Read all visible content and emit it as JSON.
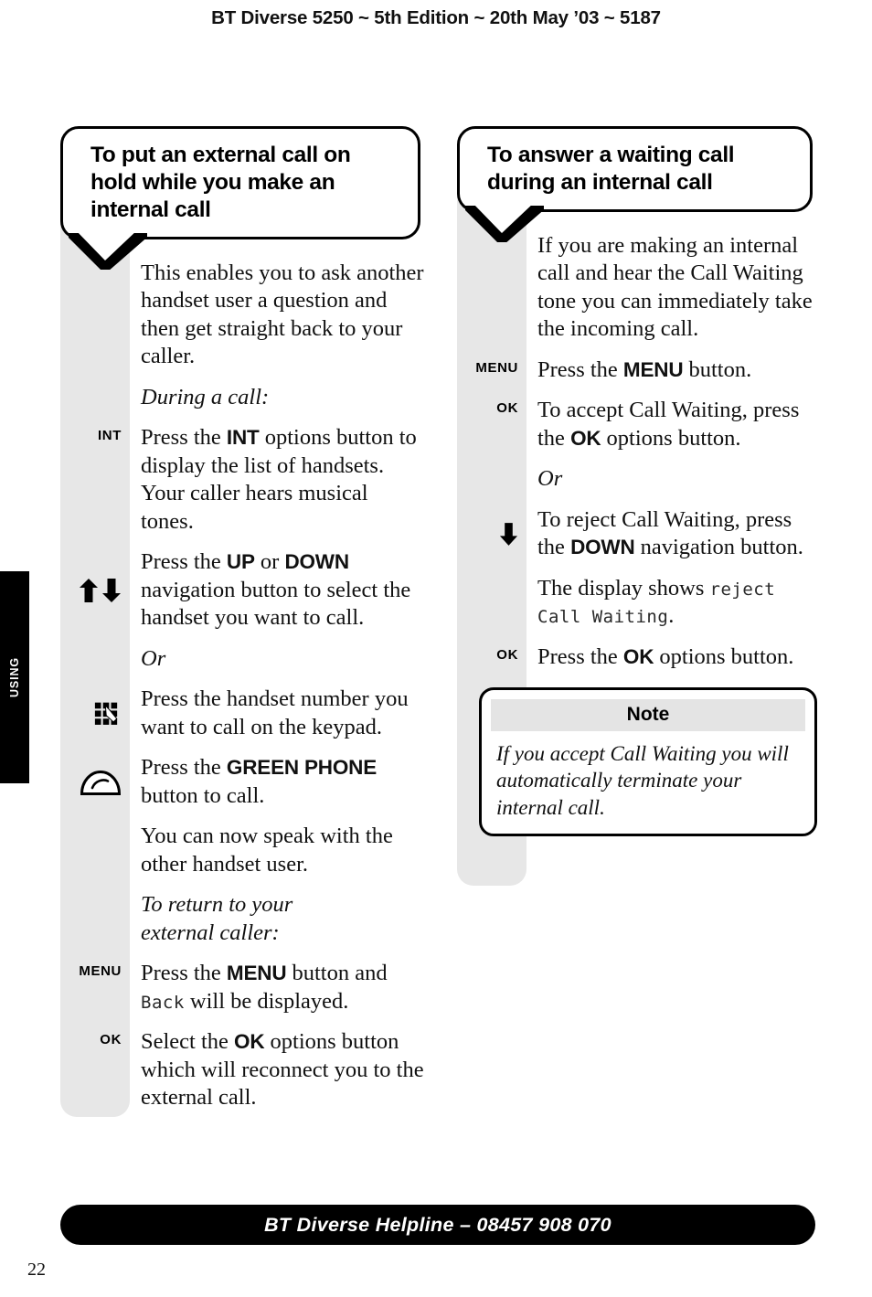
{
  "running_head": "BT Diverse 5250 ~ 5th Edition ~ 20th May ’03 ~ 5187",
  "section_tab": {
    "label": "USING"
  },
  "page_number": "22",
  "footer": {
    "text": "BT Diverse Helpline – 08457 908 070"
  },
  "left_column": {
    "heading": "To put an external call on hold while you make an internal call",
    "steps": [
      {
        "cue": "",
        "cue_icon": "",
        "text_html": "This enables you to ask another handset user a question and then get straight back to your caller."
      },
      {
        "cue": "",
        "cue_icon": "",
        "text_html": "During a call:",
        "style": "italic"
      },
      {
        "cue": "INT",
        "cue_icon": "",
        "text_html": "Press the <b>INT</b> options button to display the list of handsets. Your caller hears musical tones."
      },
      {
        "cue": "",
        "cue_icon": "up-down-arrows-icon",
        "text_html": "Press the <b>UP</b> or <b>DOWN</b> navigation button to select the handset you want to call."
      },
      {
        "cue": "",
        "cue_icon": "",
        "text_html": "Or",
        "style": "italic"
      },
      {
        "cue": "",
        "cue_icon": "keypad-icon",
        "text_html": "Press the handset number you want to call on the keypad."
      },
      {
        "cue": "",
        "cue_icon": "green-phone-icon",
        "text_html": "Press the <b>GREEN PHONE</b> button to call."
      },
      {
        "cue": "",
        "cue_icon": "",
        "text_html": "You can now speak with the other handset user."
      },
      {
        "cue": "",
        "cue_icon": "",
        "text_html": "To return to your<br>external caller:",
        "style": "italic"
      },
      {
        "cue": "MENU",
        "cue_icon": "",
        "text_html": "Press the <b>MENU</b> button and <span class=\"lcd\">Back</span> will be displayed."
      },
      {
        "cue": "OK",
        "cue_icon": "",
        "text_html": "Select the <b>OK</b> options button which will reconnect you to the external call."
      }
    ]
  },
  "right_column": {
    "heading": "To answer a waiting call during an internal call",
    "steps": [
      {
        "cue": "",
        "cue_icon": "",
        "text_html": "If you are making an internal call and hear the Call Waiting tone you can immediately take the incoming call."
      },
      {
        "cue": "MENU",
        "cue_icon": "",
        "text_html": "Press the <b>MENU</b> button."
      },
      {
        "cue": "OK",
        "cue_icon": "",
        "text_html": "To accept Call Waiting, press the <b>OK</b> options button."
      },
      {
        "cue": "",
        "cue_icon": "",
        "text_html": "Or",
        "style": "italic"
      },
      {
        "cue": "",
        "cue_icon": "down-arrow-icon",
        "text_html": "To reject Call Waiting, press the <b>DOWN</b> navigation button."
      },
      {
        "cue": "",
        "cue_icon": "",
        "text_html": "The display shows <span class=\"lcd\">reject Call Waiting</span>."
      },
      {
        "cue": "OK",
        "cue_icon": "",
        "text_html": "Press the <b>OK</b> options button."
      }
    ],
    "note": {
      "title": "Note",
      "body": "If you accept Call Waiting you will automatically terminate your internal call."
    }
  },
  "colors": {
    "gutter_grey": "#e7e7e7",
    "note_header_grey": "#e4e4e4",
    "ink": "#000000",
    "paper": "#ffffff"
  }
}
